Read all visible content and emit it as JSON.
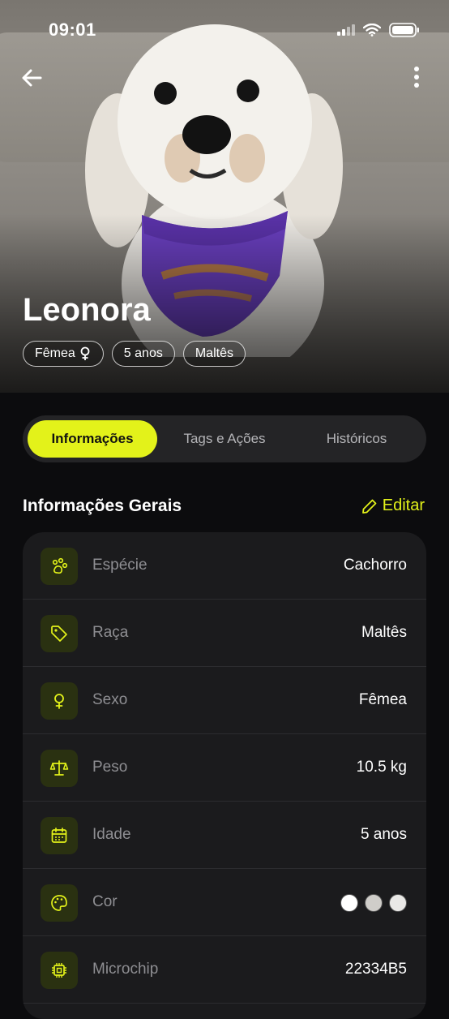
{
  "status_bar": {
    "time": "09:01"
  },
  "pet": {
    "name": "Leonora",
    "chips": [
      {
        "label": "Fêmea",
        "icon": "female-icon"
      },
      {
        "label": "5 anos"
      },
      {
        "label": "Maltês"
      }
    ]
  },
  "tabs": [
    {
      "label": "Informações",
      "active": true
    },
    {
      "label": "Tags e Ações",
      "active": false
    },
    {
      "label": "Históricos",
      "active": false
    }
  ],
  "section": {
    "title": "Informações Gerais",
    "edit_label": "Editar"
  },
  "info_rows": [
    {
      "label": "Espécie",
      "value": "Cachorro",
      "icon": "paw-icon"
    },
    {
      "label": "Raça",
      "value": "Maltês",
      "icon": "tag-icon"
    },
    {
      "label": "Sexo",
      "value": "Fêmea",
      "icon": "female-icon"
    },
    {
      "label": "Peso",
      "value": "10.5 kg",
      "icon": "scale-icon"
    },
    {
      "label": "Idade",
      "value": "5 anos",
      "icon": "calendar-icon"
    },
    {
      "label": "Cor",
      "value": "",
      "icon": "palette-icon",
      "colors": [
        "#ffffff",
        "#cfcdc9",
        "#e9e8e6"
      ]
    },
    {
      "label": "Microchip",
      "value": "22334B5",
      "icon": "chip-icon"
    }
  ],
  "colors": {
    "accent": "#e3f21a",
    "background": "#0c0c0e",
    "card": "#1b1b1d"
  }
}
